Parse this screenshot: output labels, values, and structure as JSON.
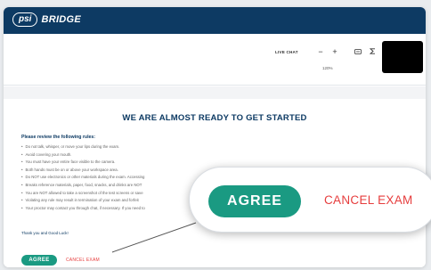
{
  "app": {
    "logo_mark": "psi",
    "logo_text": "BRIDGE"
  },
  "toolbar": {
    "live_chat": "LIVE CHAT",
    "zoom_out_icon": "minus-icon",
    "zoom_out": "−",
    "zoom_in_icon": "plus-icon",
    "zoom_in": "+",
    "zoom_level": "120%",
    "keyboard_icon": "keyboard-icon",
    "sigma_icon": "sigma-icon"
  },
  "main": {
    "heading": "WE ARE ALMOST READY TO GET STARTED",
    "rules_title": "Please review the following rules:",
    "rules": [
      "Do not talk, whisper, or move your lips during the exam.",
      "Avoid covering your mouth.",
      "You must have your entire face visible to the camera.",
      "Both hands must be on or above your workspace area.",
      "Do NOT use electronics or other materials during the exam. Accessing",
      "Breaks reference materials, paper, food, snacks, and drinks are NOT",
      "You are NOT allowed to take a screenshot of the test screens or save",
      "Violating any rule may result in termination of your exam and forfeit",
      "Your proctor may contact you through chat, if necessary. If you need to"
    ],
    "thanks": "Thank you and Good Luck!",
    "agree_label": "AGREE",
    "cancel_label": "CANCEL EXAM"
  },
  "zoom_callout": {
    "agree_label": "AGREE",
    "cancel_label": "CANCEL EXAM"
  },
  "colors": {
    "header": "#0d3a63",
    "agree": "#1a9a82",
    "cancel": "#e63d3d"
  }
}
